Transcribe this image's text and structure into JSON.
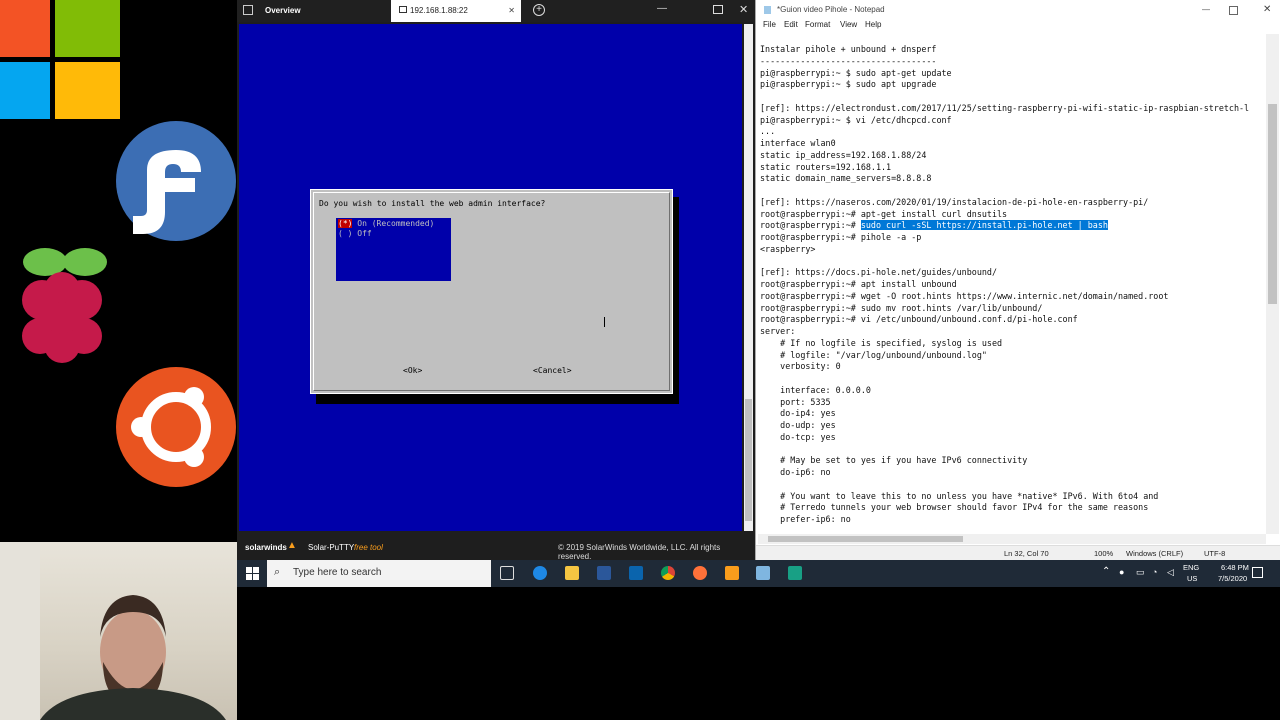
{
  "putty": {
    "tab_overview": "Overview",
    "tab_session": "192.168.1.88:22",
    "footer_brand": "solarwinds",
    "footer_product": "Solar-PuTTY",
    "footer_free": "free tool",
    "footer_copyright": "© 2019 SolarWinds Worldwide, LLC. All rights reserved."
  },
  "dialog": {
    "question": "Do you wish to install the web admin interface?",
    "option_on": "(*) On (Recommended)",
    "option_off": "( ) Off",
    "ok": "<Ok>",
    "cancel": "<Cancel>"
  },
  "notepad": {
    "title": "*Guion video Pihole - Notepad",
    "menu": [
      "File",
      "Edit",
      "Format",
      "View",
      "Help"
    ],
    "lines_before": "Instalar pihole + unbound + dnsperf\n-----------------------------------\npi@raspberrypi:~ $ sudo apt-get update\npi@raspberrypi:~ $ sudo apt upgrade\n\n[ref]: https://electrondust.com/2017/11/25/setting-raspberry-pi-wifi-static-ip-raspbian-stretch-l\npi@raspberrypi:~ $ vi /etc/dhcpcd.conf\n...\ninterface wlan0\nstatic ip_address=192.168.1.88/24\nstatic routers=192.168.1.1\nstatic domain_name_servers=8.8.8.8\n\n[ref]: https://naseros.com/2020/01/19/instalacion-de-pi-hole-en-raspberry-pi/\nroot@raspberrypi:~# apt-get install curl dnsutils",
    "selected_prefix": "root@raspberrypi:~# ",
    "selected_text": "sudo curl -sSL https://install.pi-hole.net | bash",
    "lines_after": "root@raspberrypi:~# pihole -a -p\n<raspberry>\n\n[ref]: https://docs.pi-hole.net/guides/unbound/\nroot@raspberrypi:~# apt install unbound\nroot@raspberrypi:~# wget -O root.hints https://www.internic.net/domain/named.root\nroot@raspberrypi:~# sudo mv root.hints /var/lib/unbound/\nroot@raspberrypi:~# vi /etc/unbound/unbound.conf.d/pi-hole.conf\nserver:\n    # If no logfile is specified, syslog is used\n    # logfile: \"/var/log/unbound/unbound.log\"\n    verbosity: 0\n\n    interface: 0.0.0.0\n    port: 5335\n    do-ip4: yes\n    do-udp: yes\n    do-tcp: yes\n\n    # May be set to yes if you have IPv6 connectivity\n    do-ip6: no\n\n    # You want to leave this to no unless you have *native* IPv6. With 6to4 and\n    # Terredo tunnels your web browser should favor IPv4 for the same reasons\n    prefer-ip6: no",
    "status_pos": "Ln 32, Col 70",
    "status_zoom": "100%",
    "status_eol": "Windows (CRLF)",
    "status_enc": "UTF-8"
  },
  "taskbar": {
    "search_placeholder": "Type here to search",
    "lang": "ENG",
    "region": "US",
    "time": "6:48 PM",
    "date": "7/5/2020"
  },
  "icons": {
    "windows_logo": "windows-logo",
    "fedora_logo": "fedora-logo",
    "raspberry_logo": "raspberry-pi-logo",
    "ubuntu_logo": "ubuntu-logo"
  },
  "colors": {
    "terminal_blue": "#0000aa",
    "selection": "#0078d7",
    "taskbar": "#1f2a37"
  }
}
